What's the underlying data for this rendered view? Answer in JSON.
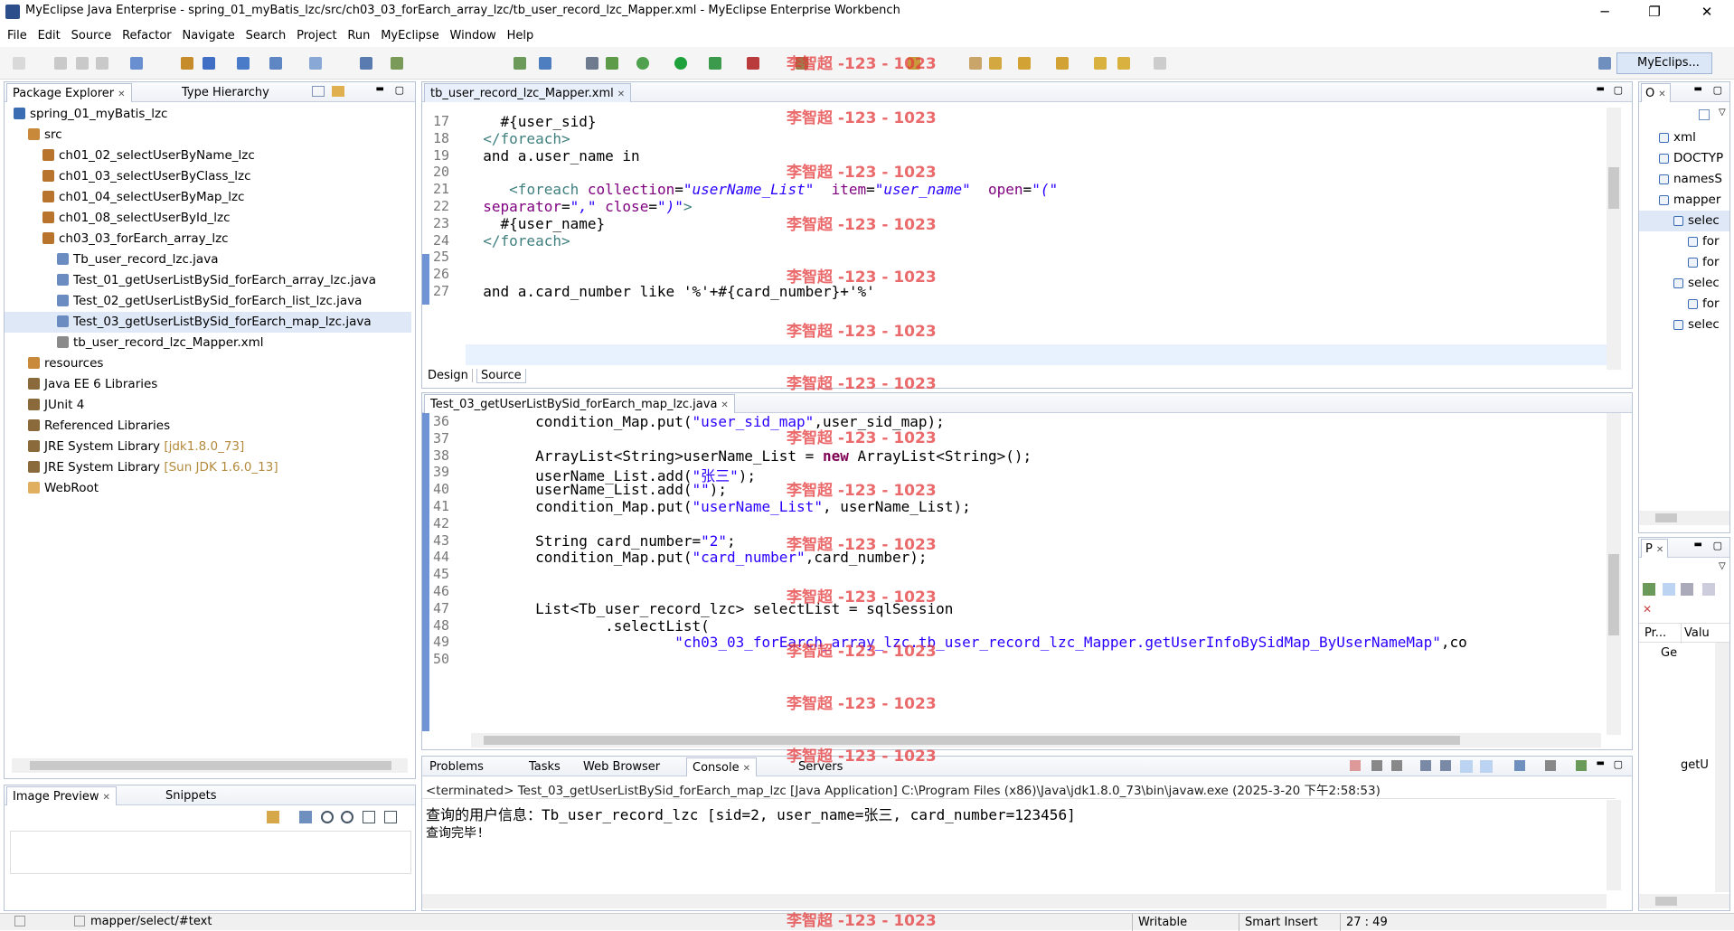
{
  "window": {
    "title": "MyEclipse Java Enterprise - spring_01_myBatis_lzc/src/ch03_03_forEarch_array_lzc/tb_user_record_lzc_Mapper.xml - MyEclipse Enterprise Workbench",
    "minimize": "─",
    "restore": "❐",
    "close": "✕"
  },
  "menu": [
    "File",
    "Edit",
    "Source",
    "Refactor",
    "Navigate",
    "Search",
    "Project",
    "Run",
    "MyEclipse",
    "Window",
    "Help"
  ],
  "perspective": "MyEclips...",
  "package_explorer": {
    "tab": "Package Explorer",
    "tab2": "Type Hierarchy",
    "items": [
      {
        "label": "spring_01_myBatis_lzc",
        "indent": 1,
        "color": "#3b6db3",
        "icon": "project-icon"
      },
      {
        "label": "src",
        "indent": 2,
        "color": "#c8893a",
        "icon": "source-folder-icon"
      },
      {
        "label": "ch01_02_selectUserByName_lzc",
        "indent": 3,
        "color": "#b8742c",
        "icon": "package-icon"
      },
      {
        "label": "ch01_03_selectUserByClass_lzc",
        "indent": 3,
        "color": "#b8742c",
        "icon": "package-icon"
      },
      {
        "label": "ch01_04_selectUserByMap_lzc",
        "indent": 3,
        "color": "#b8742c",
        "icon": "package-icon"
      },
      {
        "label": "ch01_08_selectUserById_lzc",
        "indent": 3,
        "color": "#b8742c",
        "icon": "package-icon"
      },
      {
        "label": "ch03_03_forEarch_array_lzc",
        "indent": 3,
        "color": "#b8742c",
        "icon": "package-icon"
      },
      {
        "label": "Tb_user_record_lzc.java",
        "indent": 4,
        "color": "#6b8cc0",
        "icon": "java-file-icon"
      },
      {
        "label": "Test_01_getUserListBySid_forEarch_array_lzc.java",
        "indent": 4,
        "color": "#6b8cc0",
        "icon": "java-file-icon"
      },
      {
        "label": "Test_02_getUserListBySid_forEarch_list_lzc.java",
        "indent": 4,
        "color": "#6b8cc0",
        "icon": "java-file-icon"
      },
      {
        "label": "Test_03_getUserListBySid_forEarch_map_lzc.java",
        "indent": 4,
        "color": "#6b8cc0",
        "icon": "java-file-icon",
        "selected": true
      },
      {
        "label": "tb_user_record_lzc_Mapper.xml",
        "indent": 4,
        "color": "#8a8a8a",
        "icon": "xml-file-icon"
      },
      {
        "label": "resources",
        "indent": 2,
        "color": "#c8893a",
        "icon": "folder-icon"
      },
      {
        "label": "Java EE 6 Libraries",
        "indent": 2,
        "color": "#8a6a3a",
        "icon": "library-icon"
      },
      {
        "label": "JUnit 4",
        "indent": 2,
        "color": "#8a6a3a",
        "icon": "library-icon"
      },
      {
        "label": "Referenced Libraries",
        "indent": 2,
        "color": "#8a6a3a",
        "icon": "library-icon"
      },
      {
        "label": "JRE System Library",
        "extra": "[jdk1.8.0_73]",
        "indent": 2,
        "color": "#8a6a3a",
        "icon": "library-icon"
      },
      {
        "label": "JRE System Library",
        "extra": "[Sun JDK 1.6.0_13]",
        "indent": 2,
        "color": "#8a6a3a",
        "icon": "library-icon"
      },
      {
        "label": "WebRoot",
        "indent": 2,
        "color": "#e0b060",
        "icon": "folder-icon"
      }
    ]
  },
  "image_preview": {
    "tab": "Image Preview",
    "tab2": "Snippets"
  },
  "xml_editor": {
    "tab": "tb_user_record_lzc_Mapper.xml",
    "bottom_tabs": [
      "Design",
      "Source"
    ],
    "lines": [
      {
        "n": "17",
        "html": "    #{user_sid}"
      },
      {
        "n": "18",
        "html": "  <span class='tag'>&lt;/foreach&gt;</span>"
      },
      {
        "n": "19",
        "html": "  and a.user_name in"
      },
      {
        "n": "20",
        "html": ""
      },
      {
        "n": "21",
        "html": "     <span class='tag'>&lt;foreach</span> <span class='attr'>collection</span>=<span class='str'><i>\"userName_List\"</i></span>  <span class='attr'>item</span>=<span class='str'><i>\"user_name\"</i></span>  <span class='attr'>open</span>=<span class='str'><i>\"(\"</i></span>"
      },
      {
        "n": "22",
        "html": "  <span class='attr'>separator</span>=<span class='str'><i>\",\"</i></span> <span class='attr'>close</span>=<span class='str'><i>\")\"</i></span><span class='tag'>&gt;</span>"
      },
      {
        "n": "23",
        "html": "    #{user_name}"
      },
      {
        "n": "24",
        "html": "  <span class='tag'>&lt;/foreach&gt;</span>"
      },
      {
        "n": "25",
        "html": ""
      },
      {
        "n": "26",
        "html": ""
      },
      {
        "n": "27",
        "html": "  and a.card_number like '%'+#{card_number}+'%'"
      }
    ]
  },
  "java_editor": {
    "tab": "Test_03_getUserListBySid_forEarch_map_lzc.java",
    "lines": [
      {
        "n": "36",
        "html": "        condition_Map.put(<span class='str'>\"user_sid_map\"</span>,user_sid_map);"
      },
      {
        "n": "37",
        "html": ""
      },
      {
        "n": "38",
        "html": "        ArrayList&lt;String&gt;userName_List = <span class='kw'>new</span> ArrayList&lt;String&gt;();"
      },
      {
        "n": "39",
        "html": "        userName_List.add(<span class='str'>\"张三\"</span>);"
      },
      {
        "n": "40",
        "html": "        userName_List.add(<span class='str'>\"\"</span>);"
      },
      {
        "n": "41",
        "html": "        condition_Map.put(<span class='str'>\"userName_List\"</span>, userName_List);"
      },
      {
        "n": "42",
        "html": ""
      },
      {
        "n": "43",
        "html": "        String card_number=<span class='str'>\"2\"</span>;"
      },
      {
        "n": "44",
        "html": "        condition_Map.put(<span class='str'>\"card_number\"</span>,card_number);"
      },
      {
        "n": "45",
        "html": ""
      },
      {
        "n": "46",
        "html": ""
      },
      {
        "n": "47",
        "html": "        List&lt;Tb_user_record_lzc&gt; selectList = sqlSession"
      },
      {
        "n": "48",
        "html": "                .selectList("
      },
      {
        "n": "49",
        "html": "                        <span class='str'>\"ch03_03_forEarch_array_lzc.tb_user_record_lzc_Mapper.getUserInfoBySidMap_ByUserNameMap\"</span>,co"
      },
      {
        "n": "50",
        "html": ""
      }
    ]
  },
  "console": {
    "tabs": [
      "Problems",
      "Tasks",
      "Web Browser",
      "Console",
      "Servers"
    ],
    "header": "<terminated> Test_03_getUserListBySid_forEarch_map_lzc [Java Application] C:\\Program Files (x86)\\Java\\jdk1.8.0_73\\bin\\javaw.exe (2025-3-20 下午2:58:53)",
    "lines": [
      "查询的用户信息：Tb_user_record_lzc [sid=2, user_name=张三, card_number=123456]",
      "查询完毕!"
    ]
  },
  "outline": {
    "tab": "O",
    "items": [
      {
        "label": "xml",
        "indent": 0,
        "icon": "xml-decl-icon"
      },
      {
        "label": "DOCTYP",
        "indent": 0,
        "icon": "doctype-icon"
      },
      {
        "label": "namesS",
        "indent": 0,
        "icon": "namespace-icon"
      },
      {
        "label": "mapper",
        "indent": 0,
        "icon": "element-icon"
      },
      {
        "label": "selec",
        "indent": 1,
        "icon": "element-icon",
        "selected": true
      },
      {
        "label": "for",
        "indent": 2,
        "icon": "element-icon"
      },
      {
        "label": "for",
        "indent": 2,
        "icon": "element-icon"
      },
      {
        "label": "selec",
        "indent": 1,
        "icon": "element-icon"
      },
      {
        "label": "for",
        "indent": 2,
        "icon": "element-icon"
      },
      {
        "label": "selec",
        "indent": 1,
        "icon": "element-icon"
      }
    ]
  },
  "properties": {
    "tab": "P",
    "col1": "Pr...",
    "col2": "Valu",
    "row1": "Ge",
    "row2": "getU"
  },
  "status": {
    "path": "mapper/select/#text",
    "writable": "Writable",
    "insert": "Smart Insert",
    "position": "27 : 49"
  },
  "watermark": "李智超 -123 - 1023"
}
